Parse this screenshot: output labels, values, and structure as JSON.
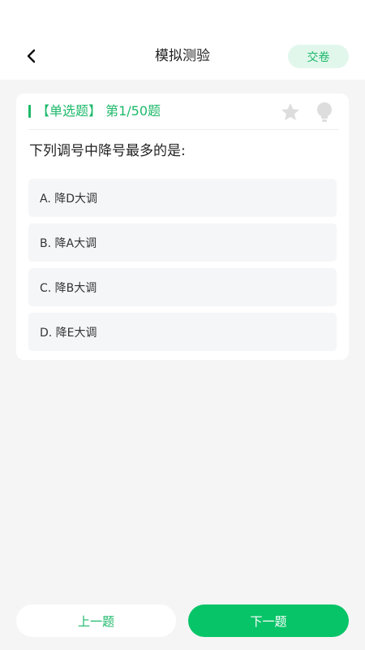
{
  "header": {
    "title": "模拟测验",
    "submit_label": "交卷",
    "back_icon": "chevron-left-icon"
  },
  "question": {
    "type_label": "【单选题】",
    "progress": "第1/50题",
    "text": "下列调号中降号最多的是:",
    "star_icon": "star-icon",
    "hint_icon": "lightbulb-icon",
    "options": [
      {
        "label": "A. 降D大调"
      },
      {
        "label": "B. 降A大调"
      },
      {
        "label": "C. 降B大调"
      },
      {
        "label": "D. 降E大调"
      }
    ]
  },
  "footer": {
    "prev_label": "上一题",
    "next_label": "下一题"
  },
  "colors": {
    "accent": "#1db96a",
    "next_button": "#07c468",
    "background": "#f5f5f5",
    "option_bg": "#f5f6f8"
  }
}
